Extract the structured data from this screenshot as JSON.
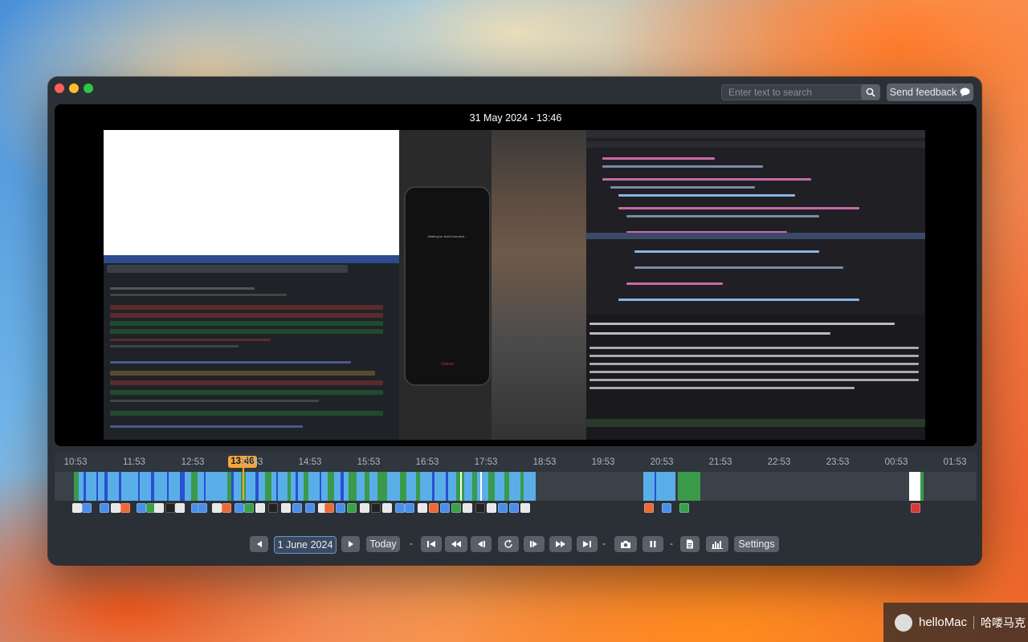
{
  "header": {
    "search_placeholder": "Enter text to search",
    "feedback_label": "Send feedback"
  },
  "preview": {
    "datetime": "31 May 2024 - 13:46",
    "phone_text": "Waiting for AuthCoroutine...",
    "phone_cancel": "Cancel"
  },
  "timeline": {
    "ticks": [
      "10:53",
      "11:53",
      "12:53",
      "13:53",
      "14:53",
      "15:53",
      "16:53",
      "17:53",
      "18:53",
      "19:53",
      "20:53",
      "21:53",
      "22:53",
      "23:53",
      "00:53",
      "01:53"
    ],
    "current": "13:46",
    "colors": {
      "blue": "#5aaee8",
      "dark_blue": "#2a4fd0",
      "green": "#3a9a4a",
      "white": "#ffffff"
    }
  },
  "toolbar": {
    "date": "1 June 2024",
    "today_label": "Today",
    "settings_label": "Settings",
    "separator": "-"
  },
  "watermark": {
    "brand": "helloMac",
    "cn": "哈喽马克"
  }
}
